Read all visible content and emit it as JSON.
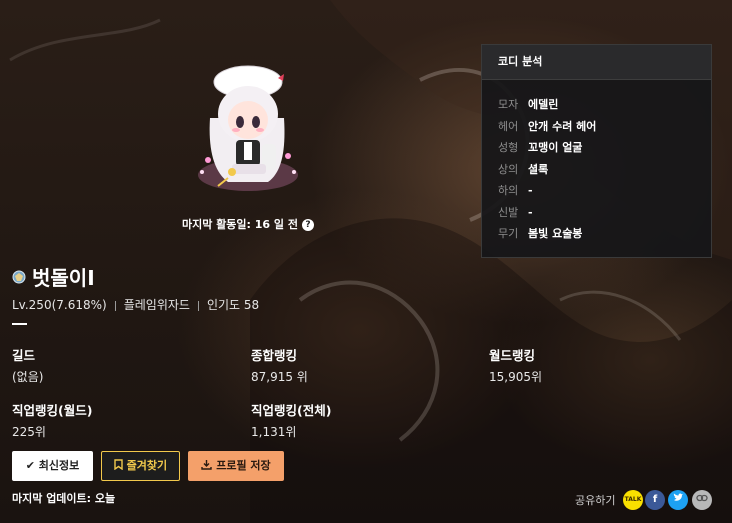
{
  "character": {
    "last_active": "마지막 활동일: 16 일 전",
    "help_icon": "?",
    "name": "벗돌이I",
    "level": "Lv.250(7.618%)",
    "job": "플레임위자드",
    "popularity": "인기도 58"
  },
  "coordination": {
    "title": "코디 분석",
    "items": [
      {
        "key": "모자",
        "value": "에델린"
      },
      {
        "key": "헤어",
        "value": "안개 수려 헤어"
      },
      {
        "key": "성형",
        "value": "꼬맹이 얼굴"
      },
      {
        "key": "상의",
        "value": "셜록"
      },
      {
        "key": "하의",
        "value": "-"
      },
      {
        "key": "신발",
        "value": "-"
      },
      {
        "key": "무기",
        "value": "봄빛 요술봉"
      }
    ]
  },
  "stats": {
    "guild": {
      "label": "길드",
      "value": "(없음)"
    },
    "total_rank": {
      "label": "종합랭킹",
      "value": "87,915 위"
    },
    "world_rank": {
      "label": "월드랭킹",
      "value": "15,905위"
    },
    "job_world_rank": {
      "label": "직업랭킹(월드)",
      "value": "225위"
    },
    "job_total_rank": {
      "label": "직업랭킹(전체)",
      "value": "1,131위"
    }
  },
  "buttons": {
    "refresh": "최신정보",
    "favorite": "즐겨찾기",
    "save_profile": "프로필 저장"
  },
  "footer": {
    "last_update": "마지막 업데이트: 오늘",
    "share_label": "공유하기",
    "share_icons": [
      "kakaotalk-icon",
      "facebook-icon",
      "twitter-icon",
      "link-icon"
    ]
  },
  "colors": {
    "favorite_accent": "#f2c94c",
    "save_accent": "#f4a06a",
    "facebook": "#3b5998",
    "twitter": "#1da1f2",
    "kakao": "#f9e000"
  }
}
